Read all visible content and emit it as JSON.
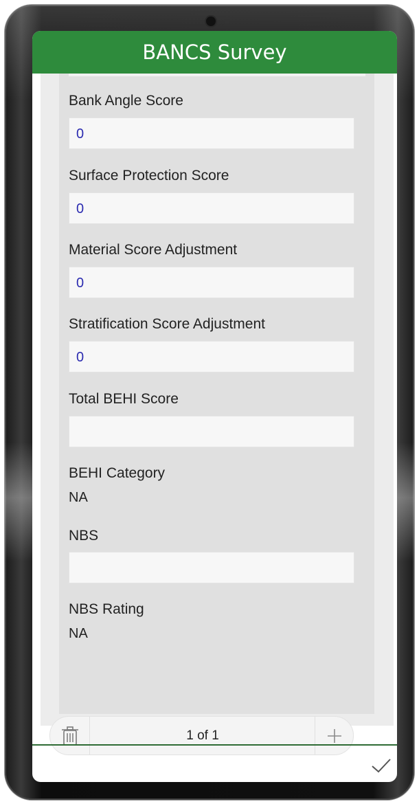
{
  "header": {
    "title": "BANCS Survey"
  },
  "colors": {
    "header_bg": "#2e8b3c",
    "value_text": "#2b2bb0"
  },
  "fields": {
    "bank_angle": {
      "label": "Bank Angle Score",
      "value": "0"
    },
    "surface_protection": {
      "label": "Surface Protection Score",
      "value": "0"
    },
    "material_adjust": {
      "label": "Material Score Adjustment",
      "value": "0"
    },
    "stratification_adjust": {
      "label": "Stratification Score Adjustment",
      "value": "0"
    },
    "total_behi": {
      "label": "Total BEHI Score",
      "value": ""
    },
    "behi_category": {
      "label": "BEHI Category",
      "value": "NA"
    },
    "nbs": {
      "label": "NBS",
      "value": ""
    },
    "nbs_rating": {
      "label": "NBS Rating",
      "value": "NA"
    }
  },
  "pager": {
    "text": "1 of 1",
    "delete_icon": "trash-icon",
    "add_icon": "plus-icon"
  },
  "footer": {
    "submit_icon": "checkmark-icon"
  }
}
